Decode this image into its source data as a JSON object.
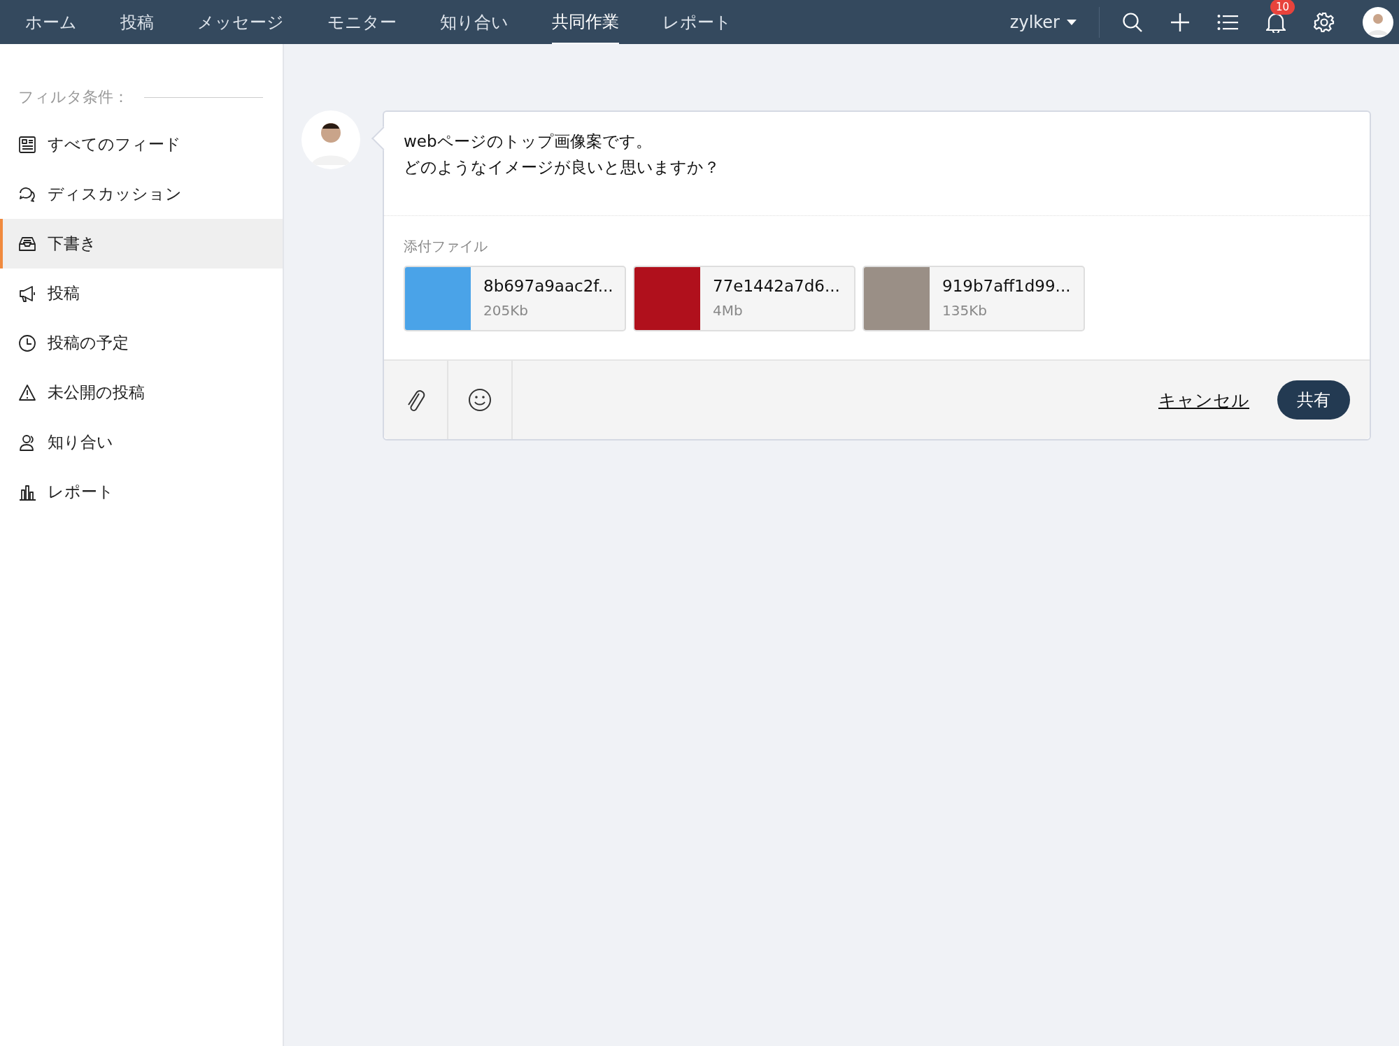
{
  "top_nav": {
    "tabs": [
      {
        "label": "ホーム",
        "selected": false
      },
      {
        "label": "投稿",
        "selected": false
      },
      {
        "label": "メッセージ",
        "selected": false
      },
      {
        "label": "モニター",
        "selected": false
      },
      {
        "label": "知り合い",
        "selected": false
      },
      {
        "label": "共同作業",
        "selected": true
      },
      {
        "label": "レポート",
        "selected": false
      }
    ],
    "account": "zylker",
    "notification_count": "10"
  },
  "sidebar": {
    "heading": "フィルタ条件：",
    "items": [
      {
        "label": "すべてのフィード",
        "selected": false
      },
      {
        "label": "ディスカッション",
        "selected": false
      },
      {
        "label": "下書き",
        "selected": true
      },
      {
        "label": "投稿",
        "selected": false
      },
      {
        "label": "投稿の予定",
        "selected": false
      },
      {
        "label": "未公開の投稿",
        "selected": false
      },
      {
        "label": "知り合い",
        "selected": false
      },
      {
        "label": "レポート",
        "selected": false
      }
    ]
  },
  "composer": {
    "message_lines": [
      "webページのトップ画像案です。",
      "どのようなイメージが良いと思いますか？"
    ],
    "attachments_label": "添付ファイル",
    "attachments": [
      {
        "name": "8b697a9aac2f...",
        "size": "205Kb",
        "color": "#4aa3e8"
      },
      {
        "name": "77e1442a7d6...",
        "size": "4Mb",
        "color": "#b0101c"
      },
      {
        "name": "919b7aff1d99...",
        "size": "135Kb",
        "color": "#9a8f86"
      }
    ],
    "cancel": "キャンセル",
    "share": "共有"
  }
}
